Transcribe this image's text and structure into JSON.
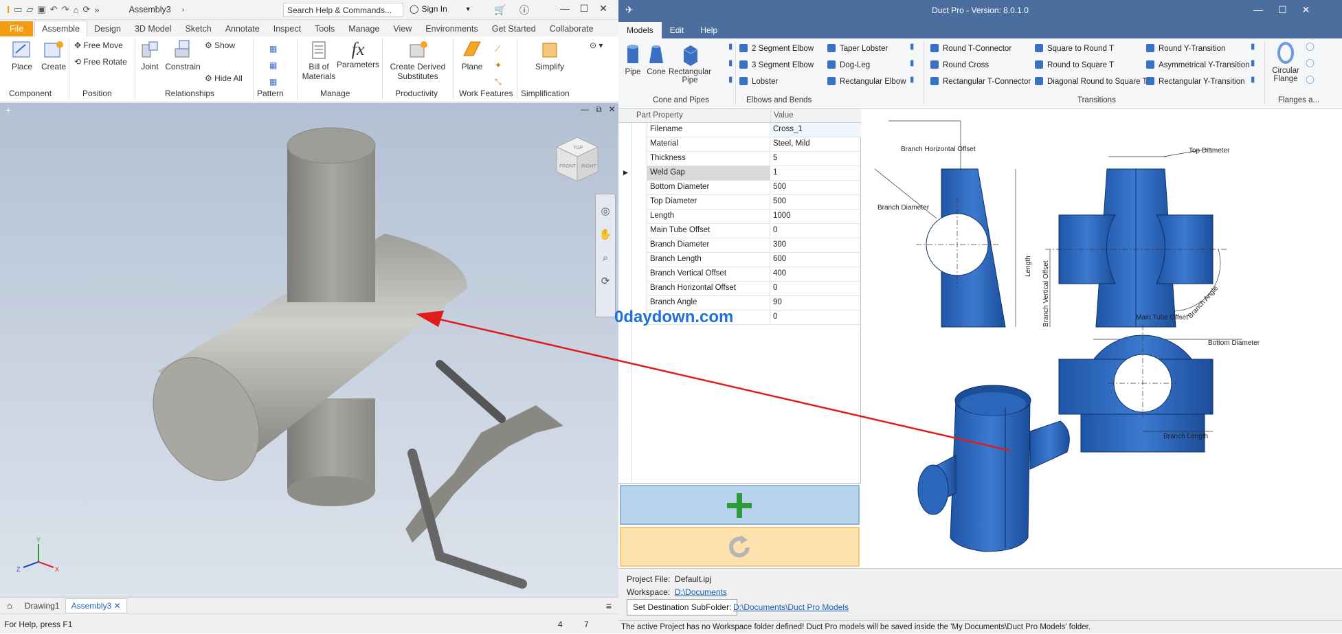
{
  "inventor": {
    "doc_title": "Assembly3",
    "search_placeholder": "Search Help & Commands...",
    "sign_in": "Sign In",
    "menu_tabs": [
      "File",
      "Assemble",
      "Design",
      "3D Model",
      "Sketch",
      "Annotate",
      "Inspect",
      "Tools",
      "Manage",
      "View",
      "Environments",
      "Get Started",
      "Collaborate"
    ],
    "ribbon": {
      "place": "Place",
      "create": "Create",
      "free_move": "Free Move",
      "free_rotate": "Free Rotate",
      "joint": "Joint",
      "constrain": "Constrain",
      "show": "Show",
      "hide_all": "Hide All",
      "bom_1": "Bill of",
      "bom_2": "Materials",
      "parameters": "Parameters",
      "derived_1": "Create Derived",
      "derived_2": "Substitutes",
      "plane": "Plane",
      "simplify": "Simplify",
      "groups": [
        "Component",
        "Position",
        "Relationships",
        "Pattern",
        "Manage",
        "Productivity",
        "Work Features",
        "Simplification"
      ]
    },
    "viewcube": {
      "top": "TOP",
      "front": "FRONT",
      "right": "RIGHT"
    },
    "axes": {
      "x": "X",
      "y": "Y",
      "z": "Z"
    },
    "bottom_tabs": [
      "Drawing1",
      "Assembly3"
    ],
    "status_text": "For Help, press F1",
    "status_n1": "4",
    "status_n2": "7"
  },
  "ductpro": {
    "title": "Duct Pro  -  Version: 8.0.1.0",
    "menu": [
      "Models",
      "Edit",
      "Help"
    ],
    "cone_pipes": {
      "label": "Cone and Pipes",
      "items": [
        "Pipe",
        "Cone",
        "Rectangular",
        "Pipe"
      ]
    },
    "elbows": {
      "label": "Elbows and Bends",
      "items": [
        "2 Segment Elbow",
        "3 Segment Elbow",
        "Lobster",
        "Taper Lobster",
        "Dog-Leg",
        "Rectangular Elbow"
      ]
    },
    "transitions": {
      "label": "Transitions",
      "items": [
        "Round T-Connector",
        "Round Cross",
        "Rectangular T-Connector",
        "Square to Round T",
        "Round to Square T",
        "Diagonal Round to Square T",
        "Round Y-Transition",
        "Asymmetrical Y-Transition",
        "Rectangular Y-Transition"
      ]
    },
    "flanges": {
      "label": "Flanges a...",
      "item_1": "Circular",
      "item_2": "Flange"
    },
    "grid_headers": [
      "Part Property",
      "Value"
    ],
    "properties": [
      {
        "name": "Filename",
        "value": "Cross_1"
      },
      {
        "name": "Material",
        "value": "Steel, Mild"
      },
      {
        "name": "Thickness",
        "value": "5"
      },
      {
        "name": "Weld Gap",
        "value": "1"
      },
      {
        "name": "Bottom Diameter",
        "value": "500"
      },
      {
        "name": "Top Diameter",
        "value": "500"
      },
      {
        "name": "Length",
        "value": "1000"
      },
      {
        "name": "Main Tube Offset",
        "value": "0"
      },
      {
        "name": "Branch Diameter",
        "value": "300"
      },
      {
        "name": "Branch Length",
        "value": "600"
      },
      {
        "name": "Branch Vertical Offset",
        "value": "400"
      },
      {
        "name": "Branch Horizontal Offset",
        "value": "0"
      },
      {
        "name": "Branch Angle",
        "value": "90"
      },
      {
        "name": "",
        "value": "0"
      }
    ],
    "watermark": "0daydown.com",
    "add_icon": "plus-icon",
    "refresh_icon": "refresh-icon",
    "project_file_label": "Project File:",
    "project_file": "Default.ipj",
    "workspace_label": "Workspace:",
    "workspace": "D:\\Documents",
    "set_dest_button": "Set Destination SubFolder:",
    "dest_path": "D:\\Documents\\Duct Pro Models",
    "warning": "The active Project has no Workspace folder defined! Duct Pro models will be saved inside the 'My Documents\\Duct Pro Models' folder.",
    "dims": {
      "branch_h_offset": "Branch Horizontal Offset",
      "top_diameter": "Top Diameter",
      "branch_diameter": "Branch Diameter",
      "length": "Length",
      "branch_v_offset": "Branch Vertical Offset",
      "branch_angle": "Branch Angle",
      "bottom_diameter": "Bottom Diameter",
      "main_tube_offset": "Main Tube Offset",
      "branch_length": "Branch Length"
    }
  },
  "colors": {
    "duct_blue": "#2a63b8",
    "title_blue": "#4b6e9e",
    "arrow": "#e11c1c",
    "file_orange": "#f39c12"
  }
}
